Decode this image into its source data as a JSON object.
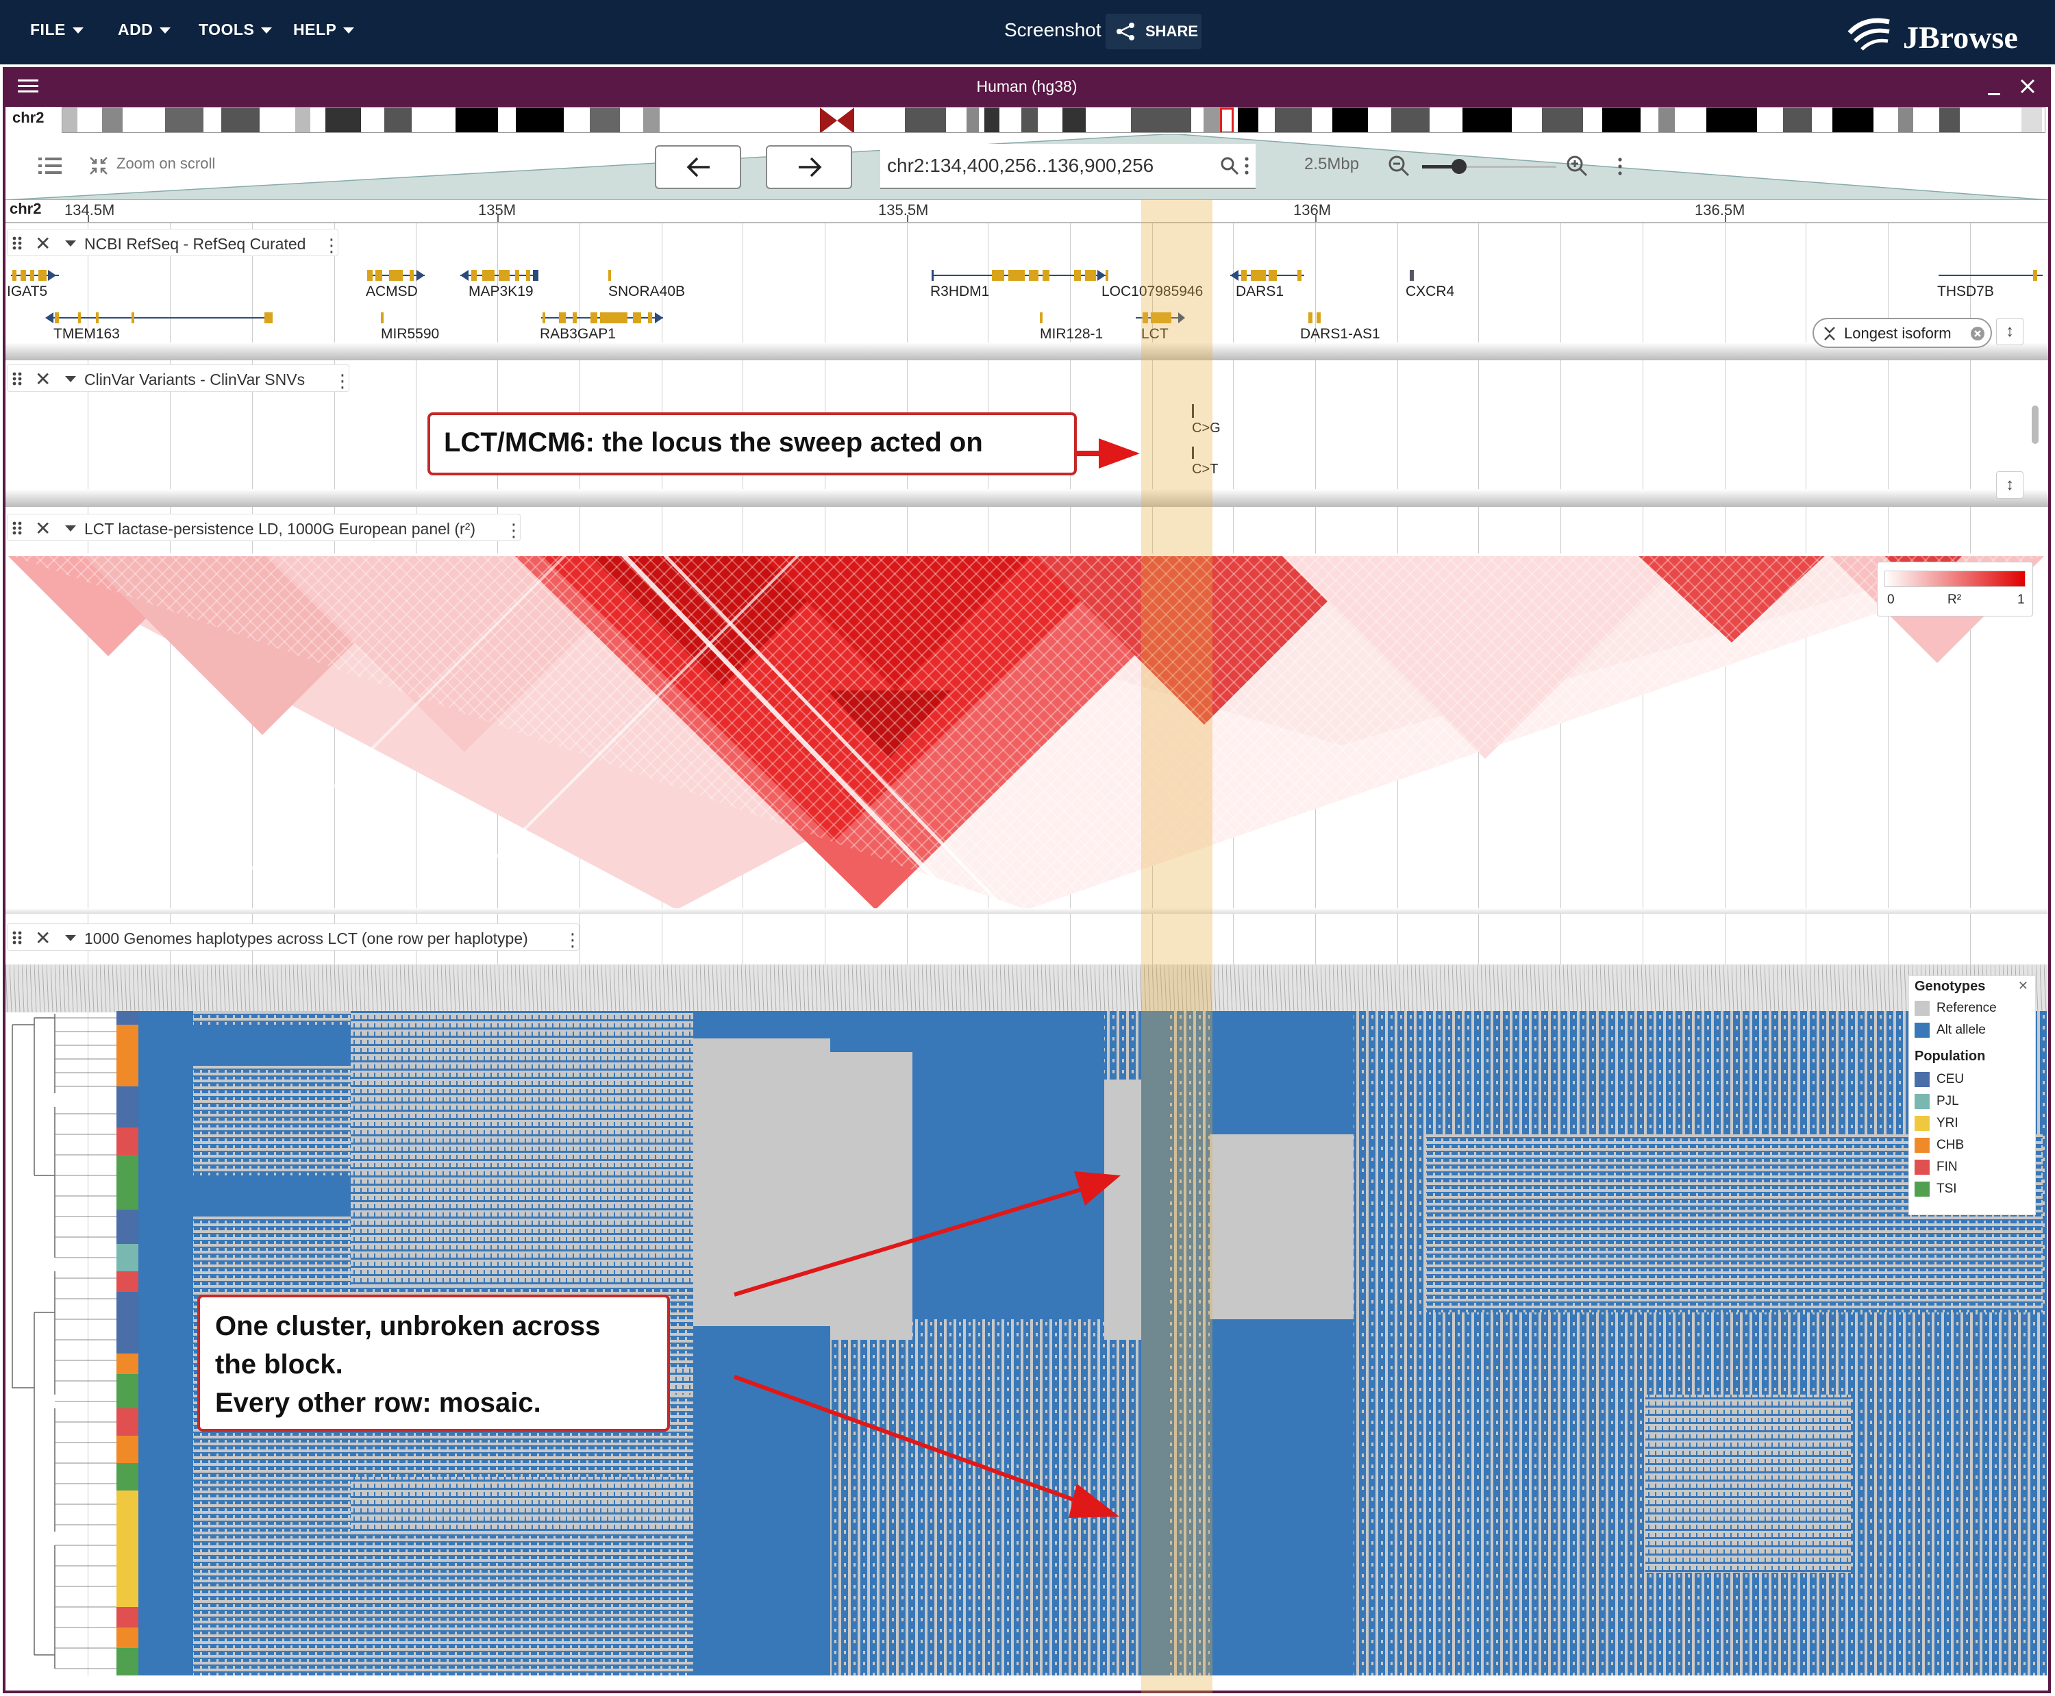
{
  "menu": {
    "file": "FILE",
    "add": "ADD",
    "tools": "TOOLS",
    "help": "HELP"
  },
  "session": {
    "title": "Screenshot",
    "share_label": "SHARE"
  },
  "brand": {
    "name": "JBrowse"
  },
  "view": {
    "title": "Human (hg38)",
    "chromosome": "chr2",
    "zoom_on_scroll": "Zoom on scroll",
    "location": "chr2:134,400,256..136,900,256",
    "bp_per_width": "2.5Mbp",
    "ruler_chrom": "chr2",
    "ruler_ticks": [
      "134.5M",
      "135M",
      "135.5M",
      "136M",
      "136.5M"
    ]
  },
  "tracks": {
    "refseq": {
      "name": "NCBI RefSeq - RefSeq Curated",
      "genes": [
        "IGAT5",
        "TMEM163",
        "ACMSD",
        "MIR5590",
        "MAP3K19",
        "RAB3GAP1",
        "SNORA40B",
        "R3HDM1",
        "MIR128-1",
        "LOC107985946",
        "LCT",
        "DARS1",
        "DARS1-AS1",
        "CXCR4",
        "THSD7B"
      ],
      "isoform_chip": "Longest isoform"
    },
    "clinvar": {
      "name": "ClinVar Variants - ClinVar SNVs",
      "variants": [
        "C>G",
        "C>T"
      ]
    },
    "ld": {
      "name": "LCT lactase-persistence LD, 1000G European panel (r²)",
      "legend": {
        "min": "0",
        "label": "R²",
        "max": "1"
      }
    },
    "haplotypes": {
      "name": "1000 Genomes haplotypes across LCT (one row per haplotype)",
      "legend": {
        "genotypes_title": "Genotypes",
        "genotypes": [
          {
            "label": "Reference",
            "color": "#c8c8c8"
          },
          {
            "label": "Alt allele",
            "color": "#3878b8"
          }
        ],
        "population_title": "Population",
        "populations": [
          {
            "label": "CEU",
            "color": "#4a6ea8"
          },
          {
            "label": "PJL",
            "color": "#78b8b0"
          },
          {
            "label": "YRI",
            "color": "#f0c840"
          },
          {
            "label": "CHB",
            "color": "#f08a28"
          },
          {
            "label": "FIN",
            "color": "#e05050"
          },
          {
            "label": "TSI",
            "color": "#50a050"
          }
        ]
      }
    }
  },
  "annotations": {
    "locus_callout": "LCT/MCM6: the locus the sweep acted on",
    "cluster_callout_lines": [
      "One cluster, unbroken across",
      "the block.",
      "Every other row: mosaic."
    ]
  },
  "colors": {
    "app_bar": "#0d233f",
    "view_header": "#5a1846",
    "highlight": "#e6aa3c",
    "gene": "#d9a41c",
    "ld_max": "#e00000",
    "callout_border": "#c62828"
  }
}
